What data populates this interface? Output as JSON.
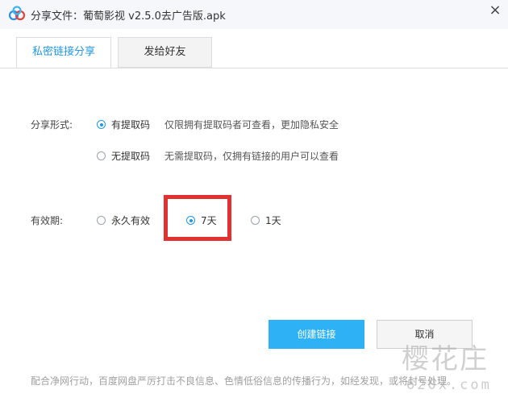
{
  "titlebar": {
    "title": "分享文件：葡萄影视 v2.5.0去广告版.apk",
    "close_glyph": "×",
    "logo_icon": "baidu-cloud-logo-icon"
  },
  "tabs": [
    {
      "label": "私密链接分享",
      "active": true
    },
    {
      "label": "发给好友",
      "active": false
    }
  ],
  "share_mode": {
    "label": "分享形式:",
    "options": [
      {
        "label": "有提取码",
        "desc": "仅限拥有提取码者可查看，更加隐私安全",
        "checked": true
      },
      {
        "label": "无提取码",
        "desc": "无需提取码，仅拥有链接的用户可以查看",
        "checked": false
      }
    ]
  },
  "validity": {
    "label": "有效期:",
    "options": [
      {
        "label": "永久有效",
        "checked": false
      },
      {
        "label": "7天",
        "checked": true
      },
      {
        "label": "1天",
        "checked": false
      }
    ]
  },
  "buttons": {
    "create": "创建链接",
    "cancel": "取消"
  },
  "footer_note": "配合净网行动，百度网盘严厉打击不良信息、色情低俗信息的传播行为，如经发现，或将封号处理。",
  "watermark": {
    "main": "樱花庄",
    "sub": "620x.com"
  },
  "colors": {
    "accent": "#2397e0",
    "primary_button": "#2fb2f5",
    "highlight": "#e23131"
  }
}
